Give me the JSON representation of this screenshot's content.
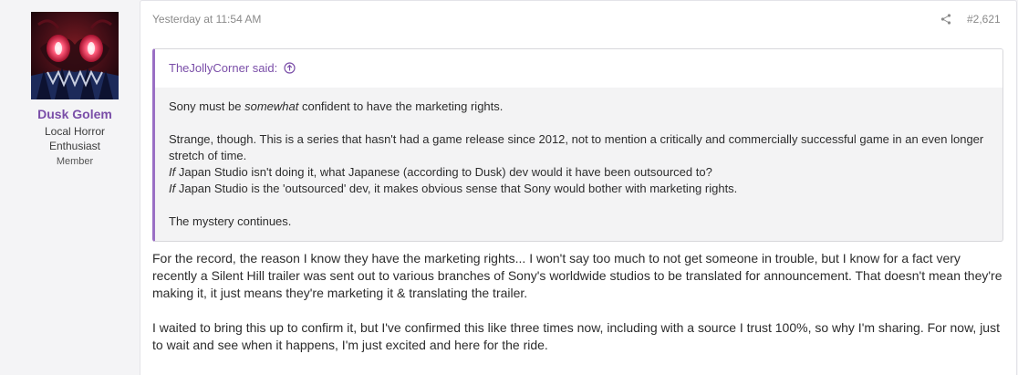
{
  "user": {
    "name": "Dusk Golem",
    "title": "Local Horror Enthusiast",
    "role": "Member"
  },
  "post": {
    "date": "Yesterday at 11:54 AM",
    "number": "#2,621",
    "share_icon": "share-icon"
  },
  "quote": {
    "author": "TheJollyCorner said:",
    "up_icon": "arrow-up-circle-icon",
    "line1_pre": "Sony must be ",
    "line1_em": "somewhat",
    "line1_post": " confident to have the marketing rights.",
    "line2": "Strange, though. This is a series that hasn't had a game release since 2012, not to mention a critically and commercially successful game in an even longer stretch of time.",
    "line3_em": "If",
    "line3_rest": " Japan Studio isn't doing it, what Japanese (according to Dusk) dev would it have been outsourced to?",
    "line4_em": "If",
    "line4_rest": " Japan Studio is the 'outsourced' dev, it makes obvious sense that Sony would bother with marketing rights.",
    "line5": "The mystery continues."
  },
  "message": {
    "paragraph1": "For the record, the reason I know they have the marketing rights... I won't say too much to not get someone in trouble, but I know for a fact very recently a Silent Hill trailer was sent out to various branches of Sony's worldwide studios to be translated for announcement. That doesn't mean they're making it, it just means they're marketing it & translating the trailer.",
    "paragraph2": "I waited to bring this up to confirm it, but I've confirmed this like three times now, including with a source I trust 100%, so why I'm sharing. For now, just to wait and see when it happens, I'm just excited and here for the ride."
  },
  "colors": {
    "accent": "#7a4ea8",
    "quote_border": "#9a6fc4"
  }
}
